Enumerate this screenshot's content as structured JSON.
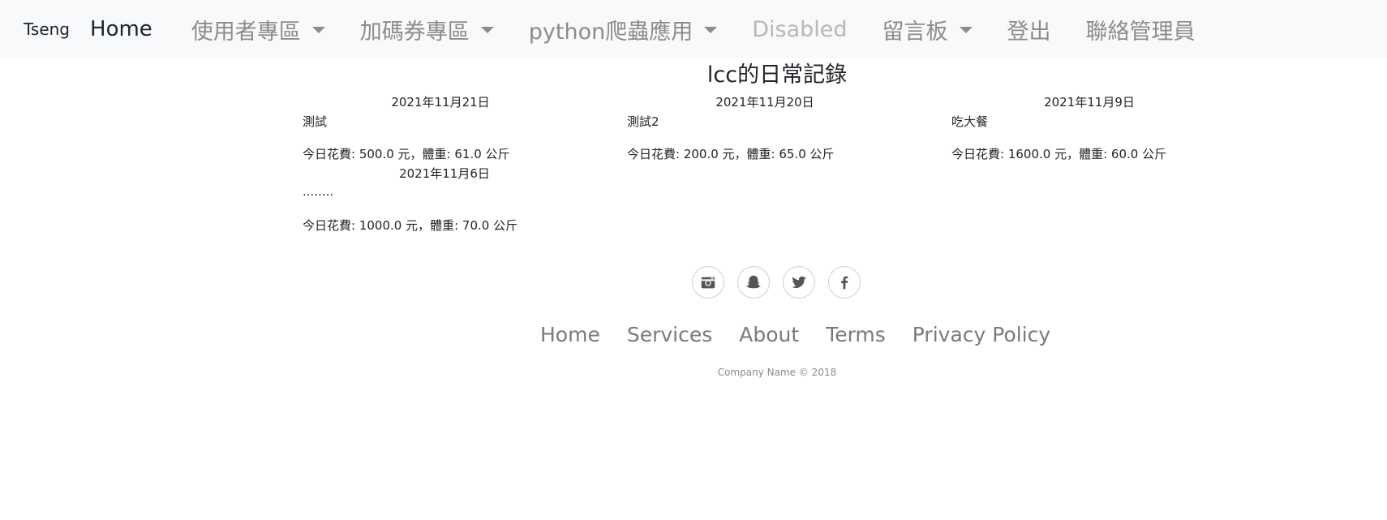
{
  "navbar": {
    "brand": "Tseng",
    "items": [
      {
        "label": "Home"
      },
      {
        "label": "使用者專區"
      },
      {
        "label": "加碼券專區"
      },
      {
        "label": "python爬蟲應用"
      },
      {
        "label": "Disabled"
      },
      {
        "label": "留言板"
      },
      {
        "label": "登出"
      },
      {
        "label": "聯絡管理員"
      }
    ]
  },
  "page": {
    "title": "lcc的日常記錄"
  },
  "entries": [
    {
      "date": "2021年11月21日",
      "subject": "測試",
      "stats": "今日花費: 500.0 元，體重: 61.0 公斤"
    },
    {
      "date": "2021年11月20日",
      "subject": "測試2",
      "stats": "今日花費: 200.0 元，體重: 65.0 公斤"
    },
    {
      "date": "2021年11月9日",
      "subject": "吃大餐",
      "stats": "今日花費: 1600.0 元，體重: 60.0 公斤"
    },
    {
      "date": "2021年11月6日",
      "subject": "........",
      "stats": "今日花費: 1000.0 元，體重: 70.0 公斤"
    }
  ],
  "footer": {
    "social": [
      "instagram-icon",
      "snapchat-icon",
      "twitter-icon",
      "facebook-icon"
    ],
    "links": [
      {
        "label": "Home"
      },
      {
        "label": "Services"
      },
      {
        "label": "About"
      },
      {
        "label": "Terms"
      },
      {
        "label": "Privacy Policy"
      }
    ],
    "copyright": "Company Name © 2018"
  }
}
